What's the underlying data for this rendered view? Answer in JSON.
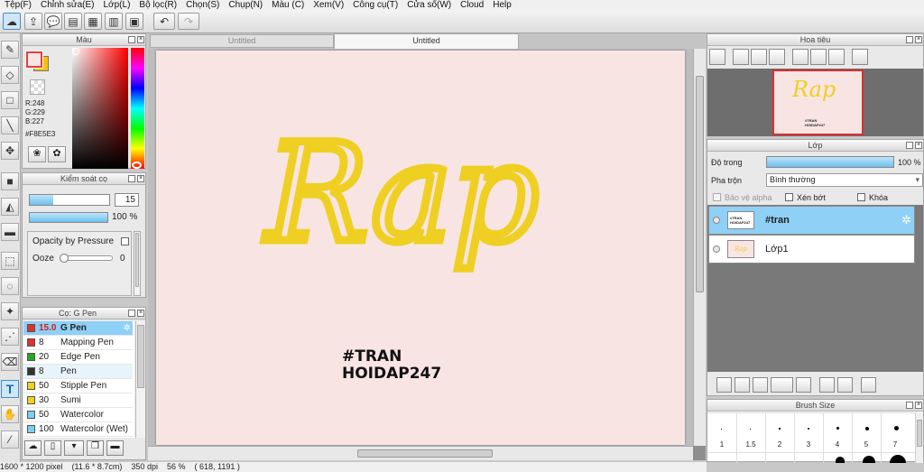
{
  "menu": [
    "Tệp(F)",
    "Chỉnh sửa(E)",
    "Lớp(L)",
    "Bộ lọc(R)",
    "Chọn(S)",
    "Chụp(N)",
    "Màu (C)",
    "Xem(V)",
    "Công cụ(T)",
    "Cửa sổ(W)",
    "Cloud",
    "Help"
  ],
  "tabs": [
    "Untitled",
    "Untitled"
  ],
  "color_panel": {
    "title": "Màu",
    "r": "R:248",
    "g": "G:229",
    "b": "B:227",
    "hex": "#F8E5E3",
    "fg_color": "#F8E5E3",
    "bg_color": "#F5C400"
  },
  "brush_control": {
    "title": "Kiểm soát cọ",
    "size": "15",
    "opacity": "100 %",
    "opacity_pressure": "Opacity by Pressure",
    "ooze_label": "Ooze",
    "ooze_value": "0"
  },
  "brush_list": {
    "title": "Cọ: G Pen",
    "items": [
      {
        "size": "15.0",
        "name": "G Pen",
        "color": "#e03030",
        "selected": true
      },
      {
        "size": "8",
        "name": "Mapping Pen",
        "color": "#e03030"
      },
      {
        "size": "20",
        "name": "Edge Pen",
        "color": "#22aa22"
      },
      {
        "size": "8",
        "name": "Pen",
        "color": "#333333"
      },
      {
        "size": "50",
        "name": "Stipple Pen",
        "color": "#f2d21a"
      },
      {
        "size": "30",
        "name": "Sumi",
        "color": "#f2d21a"
      },
      {
        "size": "50",
        "name": "Watercolor",
        "color": "#7ad0f0"
      },
      {
        "size": "100",
        "name": "Watercolor (Wet)",
        "color": "#7ad0f0"
      }
    ]
  },
  "canvas": {
    "background": "#F8E5E3",
    "art_text": "Rap",
    "art_color": "#EFCF22",
    "caption_line1": "#TRAN",
    "caption_line2": "HOIDAP247"
  },
  "navigator": {
    "title": "Hoa tiêu",
    "thumb_text": "Rap",
    "thumb_caption": "#TRAN HOIDAP247"
  },
  "layer_panel": {
    "title": "Lớp",
    "opacity_label": "Độ trong",
    "opacity_value": "100 %",
    "blend_label": "Pha trộn",
    "blend_value": "Bình thường",
    "protect_alpha": "Bảo vệ alpha",
    "clipping": "Xén bớt",
    "lock": "Khóa",
    "layers": [
      {
        "name": "#tran",
        "selected": true,
        "thumb_text": "#TRAN HOIDAP247"
      },
      {
        "name": "Lớp1",
        "selected": false,
        "thumb_text": "Rap"
      }
    ]
  },
  "brush_size_panel": {
    "title": "Brush Size",
    "sizes": [
      "1",
      "1.5",
      "2",
      "3",
      "4",
      "5",
      "7"
    ]
  },
  "status": {
    "dimensions": "1600 * 1200 pixel",
    "physical": "(11.6 * 8.7cm)",
    "dpi": "350 dpi",
    "zoom": "56 %",
    "coords": "( 618, 1191 )"
  }
}
